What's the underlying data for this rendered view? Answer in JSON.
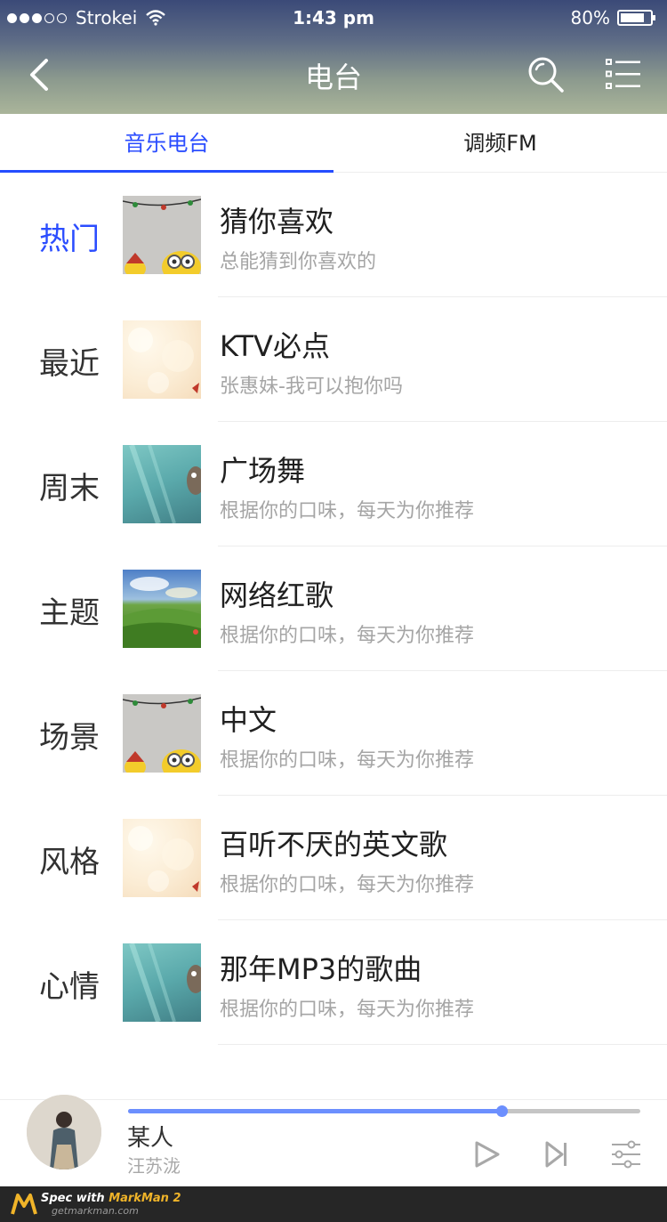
{
  "status_bar": {
    "carrier": "Strokei",
    "time": "1:43 pm",
    "battery": "80%",
    "battery_level": 0.8,
    "signal_filled": 3,
    "signal_total": 5
  },
  "nav": {
    "title": "电台",
    "back_icon": "chevron-left-icon",
    "search_icon": "search-icon",
    "menu_icon": "list-menu-icon"
  },
  "tabs": [
    {
      "label": "音乐电台",
      "active": true
    },
    {
      "label": "调频FM",
      "active": false
    }
  ],
  "list": [
    {
      "category": "热门",
      "active": true,
      "title": "猜你喜欢",
      "subtitle": "总能猜到你喜欢的",
      "thumb": "minion"
    },
    {
      "category": "最近",
      "active": false,
      "title": "KTV必点",
      "subtitle": "张惠妹-我可以抱你吗",
      "thumb": "bokeh"
    },
    {
      "category": "周末",
      "active": false,
      "title": "广场舞",
      "subtitle": "根据你的口味，每天为你推荐",
      "thumb": "sea"
    },
    {
      "category": "主题",
      "active": false,
      "title": "网络红歌",
      "subtitle": "根据你的口味，每天为你推荐",
      "thumb": "field"
    },
    {
      "category": "场景",
      "active": false,
      "title": "中文",
      "subtitle": "根据你的口味，每天为你推荐",
      "thumb": "minion"
    },
    {
      "category": "风格",
      "active": false,
      "title": "百听不厌的英文歌",
      "subtitle": "根据你的口味，每天为你推荐",
      "thumb": "bokeh"
    },
    {
      "category": "心情",
      "active": false,
      "title": "那年MP3的歌曲",
      "subtitle": "根据你的口味，每天为你推荐",
      "thumb": "sea"
    }
  ],
  "player": {
    "song": "某人",
    "artist": "汪苏泷",
    "progress": 0.73,
    "play_icon": "play-icon",
    "next_icon": "skip-next-icon",
    "settings_icon": "equalizer-icon"
  },
  "footer": {
    "brand_prefix": "Spec with ",
    "brand_name": "MarkMan 2",
    "url": "getmarkman.com"
  },
  "colors": {
    "accent": "#2b4dff",
    "underline": "#254dff",
    "progress": "#6c8ffe",
    "title_text": "#202020",
    "category_text": "#323232",
    "subtitle_text": "#a5a5a5",
    "divider": "#ededed",
    "track": "#c5c5c5",
    "icon_gray": "#a8a8a8"
  }
}
